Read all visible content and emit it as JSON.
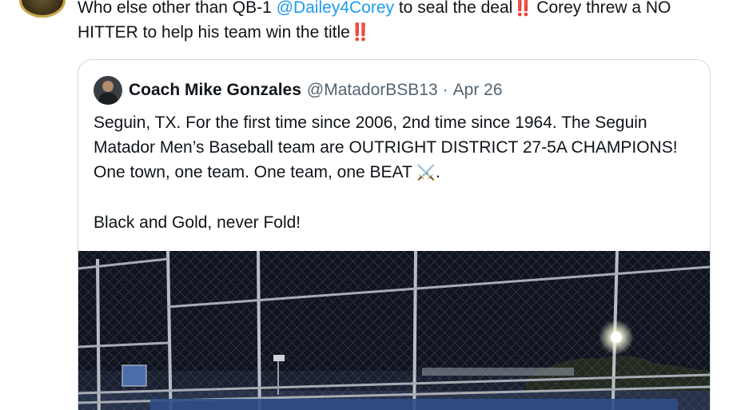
{
  "tweet": {
    "text_1": "Who else other than QB-1 ",
    "mention": "@Dailey4Corey",
    "text_2": " to seal the deal",
    "bang_1": "‼️",
    "text_3": " Corey threw a NO HITTER to help his team win the title",
    "bang_2": "‼️"
  },
  "quote": {
    "author_name": "Coach Mike Gonzales",
    "author_handle": "@MatadorBSB13",
    "separator": "·",
    "date": "Apr 26",
    "paragraph_1": "Seguin, TX. For the first time since 2006, 2nd time since 1964. The Seguin Matador Men’s Baseball team  are OUTRIGHT DISTRICT 27-5A CHAMPIONS! One town, one team. One team, one BEAT ",
    "swords_emoji": "⚔️",
    "paragraph_1_end": ".",
    "paragraph_2": "Black and Gold, never Fold!"
  },
  "colors": {
    "mention": "#1d9bf0",
    "secondary_text": "#536471",
    "border": "#cfd9de"
  }
}
